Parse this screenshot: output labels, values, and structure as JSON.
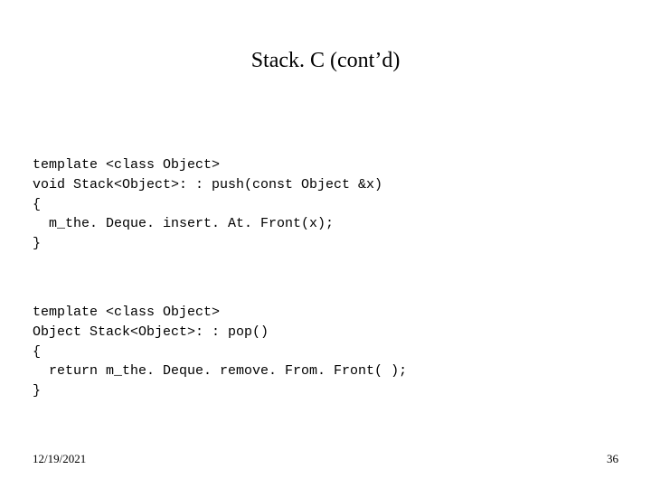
{
  "title": "Stack. C (cont’d)",
  "code1": {
    "l1": "template <class Object>",
    "l2": "void Stack<Object>: : push(const Object &x)",
    "l3": "{",
    "l4": "  m_the. Deque. insert. At. Front(x);",
    "l5": "}"
  },
  "code2": {
    "l1": "template <class Object>",
    "l2": "Object Stack<Object>: : pop()",
    "l3": "{",
    "l4": "  return m_the. Deque. remove. From. Front( );",
    "l5": "}"
  },
  "footer": {
    "date": "12/19/2021",
    "page": "36"
  }
}
